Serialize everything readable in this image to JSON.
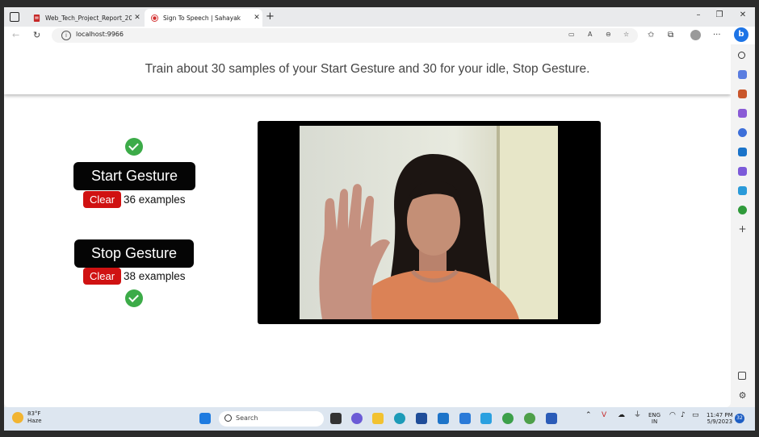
{
  "browser": {
    "tabs": [
      {
        "label": "Web_Tech_Project_Report_2010...",
        "active": false,
        "icon": "pdf-icon"
      },
      {
        "label": "Sign To Speech | Sahayak",
        "active": true,
        "icon": "record-icon"
      }
    ],
    "new_tab": "+",
    "url": "localhost:9966",
    "window_controls": {
      "minimize": "–",
      "maximize": "❐",
      "close": "✕"
    },
    "more": "···"
  },
  "page": {
    "heading": "Train about 30 samples of your Start Gesture and 30 for your idle, Stop Gesture.",
    "start": {
      "button": "Start Gesture",
      "clear": "Clear",
      "count": "36 examples",
      "trained": true
    },
    "stop": {
      "button": "Stop Gesture",
      "clear": "Clear",
      "count": "38 examples",
      "trained": true
    },
    "colors": {
      "check": "#3cab48",
      "clear": "#d01212",
      "button": "#050505"
    }
  },
  "taskbar": {
    "weather_temp": "83°F",
    "weather_desc": "Haze",
    "search_placeholder": "Search",
    "lang": "ENG",
    "region": "IN",
    "time": "11:47 PM",
    "date": "5/9/2023",
    "notifications": "32"
  }
}
